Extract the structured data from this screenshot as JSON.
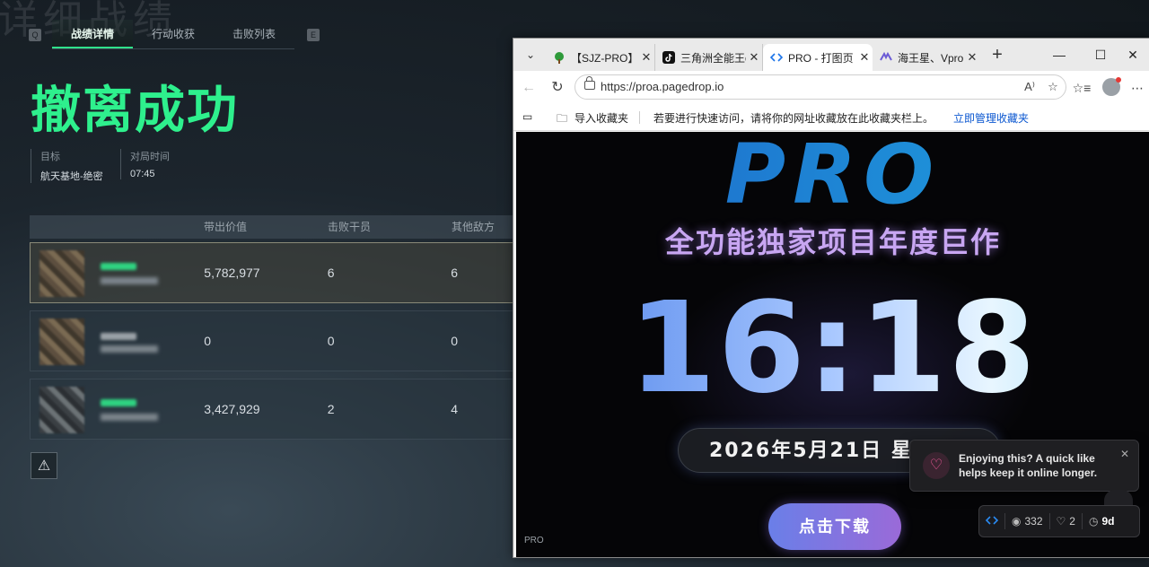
{
  "game": {
    "bg_title": "详细战绩",
    "key_left": "Q",
    "key_right": "E",
    "tabs": [
      "战绩详情",
      "行动收获",
      "击败列表"
    ],
    "result_title": "撤离成功",
    "info": [
      {
        "label": "目标",
        "value": "航天基地-绝密"
      },
      {
        "label": "对局时间",
        "value": "07:45"
      }
    ],
    "table": {
      "headers": [
        "",
        "带出价值",
        "击败干员",
        "其他敌方"
      ],
      "rows": [
        {
          "value": "5,782,977",
          "kills": "6",
          "others": "6"
        },
        {
          "value": "0",
          "kills": "0",
          "others": "0"
        },
        {
          "value": "3,427,929",
          "kills": "2",
          "others": "4"
        }
      ]
    },
    "warn_icon": "⚠"
  },
  "browser": {
    "tabs": [
      {
        "title": "【SJZ-PRO】免",
        "icon": "tree-icon"
      },
      {
        "title": "三角洲全能王d",
        "icon": "tiktok-icon"
      },
      {
        "title": "PRO - 打图页",
        "icon": "code-icon"
      },
      {
        "title": "海王星、Vpro",
        "icon": "vpro-icon"
      }
    ],
    "url": "https://proa.pagedrop.io",
    "favbar": {
      "import": "导入收藏夹",
      "hint": "若要进行快速访问，请将你的网址收藏放在此收藏夹栏上。",
      "manage": "立即管理收藏夹"
    }
  },
  "page": {
    "logo": "PRO",
    "subtitle": "全功能独家项目年度巨作",
    "clock": "16:18",
    "date": "2026年5月21日 星",
    "download": "点击下载",
    "corner": "PRO"
  },
  "toast": {
    "message": "Enjoying this? A quick like helps keep it online longer."
  },
  "stats": {
    "views": "332",
    "likes": "2",
    "age": "9d"
  }
}
